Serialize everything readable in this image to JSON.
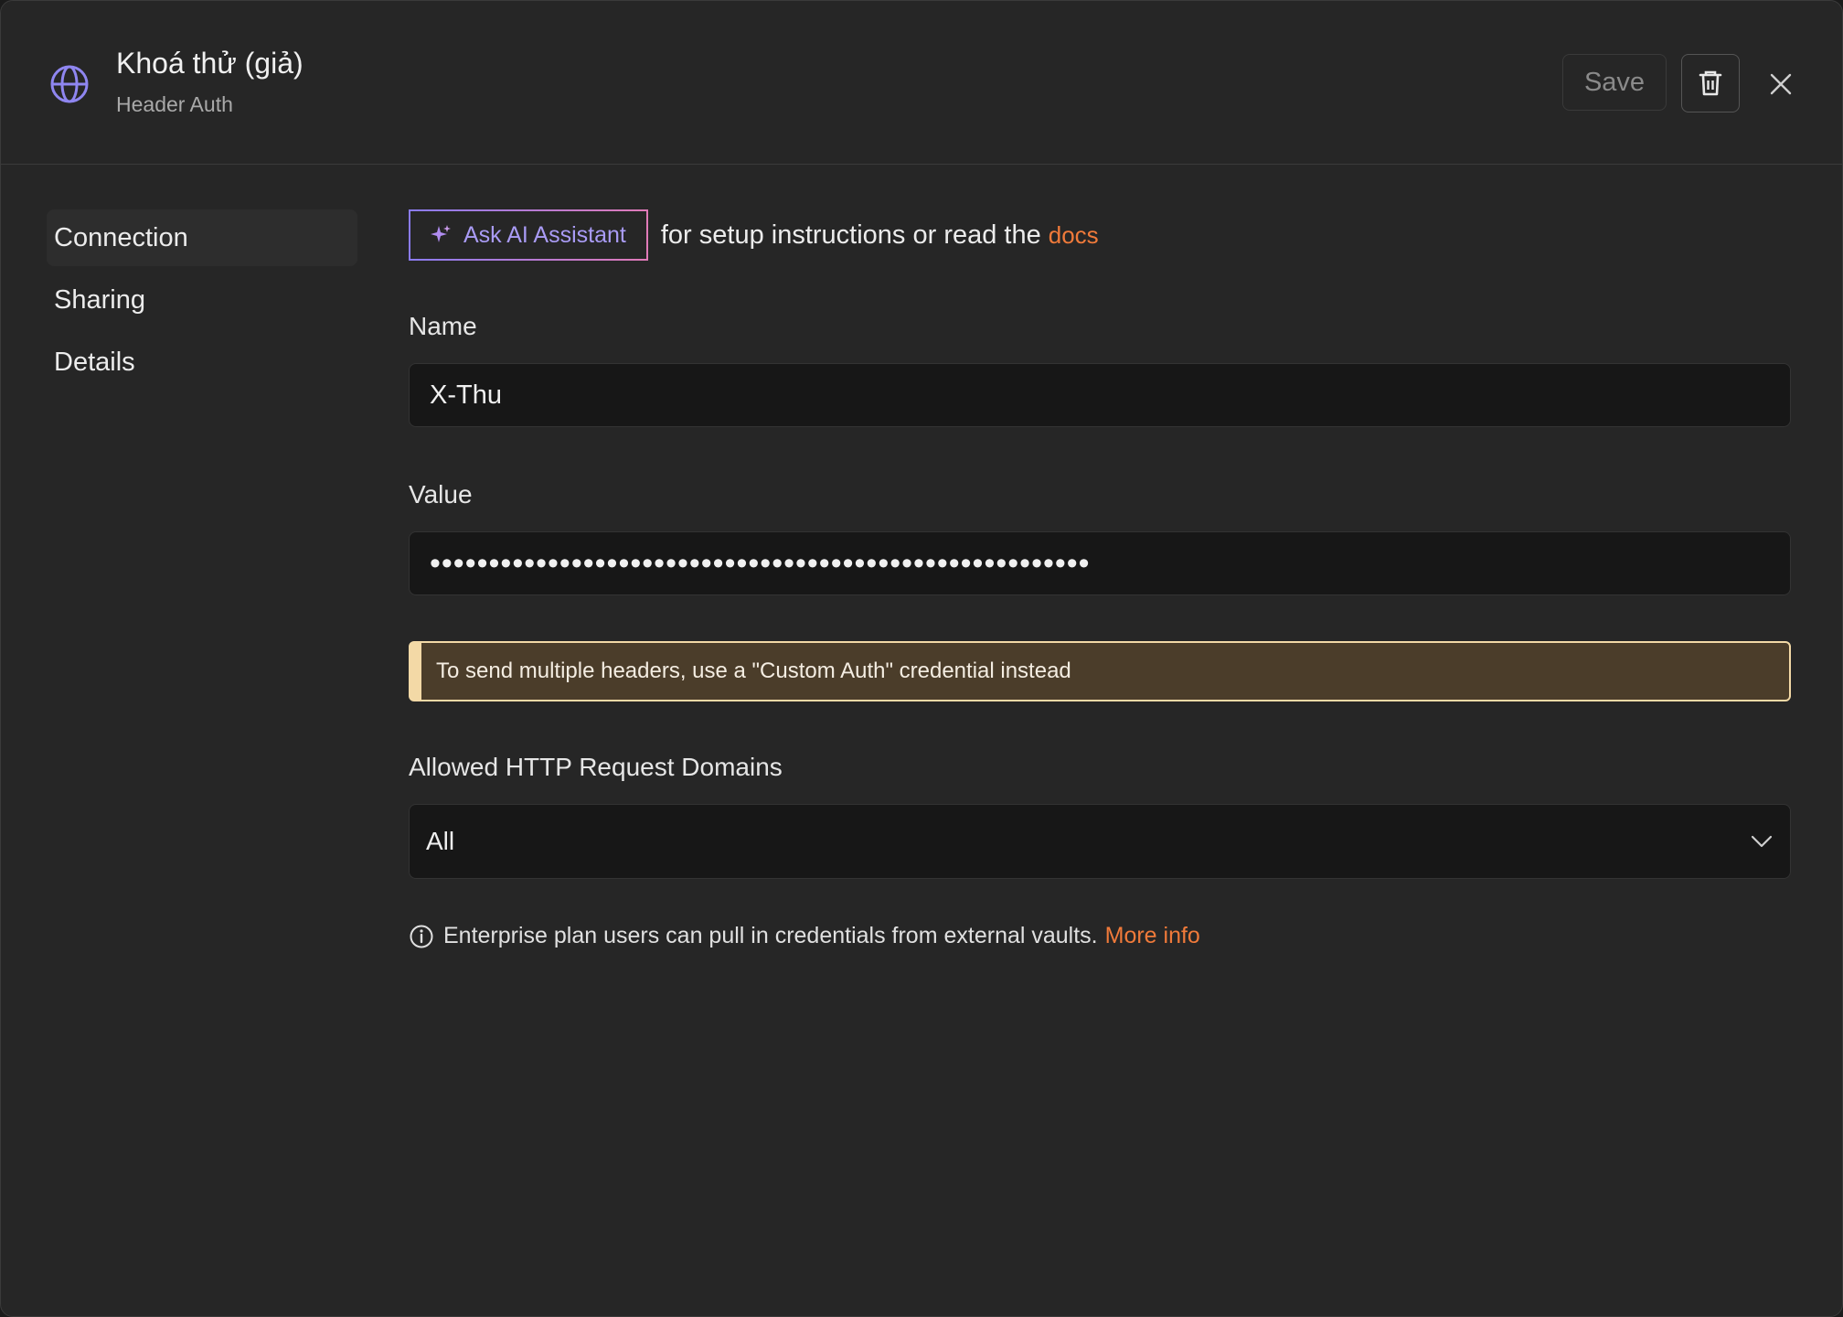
{
  "header": {
    "title": "Khoá thử (giả)",
    "subtitle": "Header Auth",
    "save_label": "Save",
    "icons": {
      "type": "globe-icon",
      "delete": "trash-icon",
      "close": "close-icon"
    }
  },
  "sidebar": {
    "items": [
      {
        "label": "Connection",
        "active": true
      },
      {
        "label": "Sharing",
        "active": false
      },
      {
        "label": "Details",
        "active": false
      }
    ]
  },
  "assistant": {
    "button_label": "Ask AI Assistant",
    "text": "for setup instructions or read the",
    "docs_link": "docs"
  },
  "form": {
    "name": {
      "label": "Name",
      "value": "X-Thu"
    },
    "value": {
      "label": "Value",
      "value": "••••••••••••••••••••••••••••••••••••••••••••••••••••••••"
    },
    "notice": "To send multiple headers, use a \"Custom Auth\" credential instead",
    "domains": {
      "label": "Allowed HTTP Request Domains",
      "selected": "All"
    }
  },
  "info": {
    "text": "Enterprise plan users can pull in credentials from external vaults.",
    "link": "More info"
  },
  "colors": {
    "accent_link": "#f07a3a",
    "ai_purple": "#a99bf5",
    "notice_bg": "#4b3d2a",
    "notice_border": "#f3d9a6"
  }
}
